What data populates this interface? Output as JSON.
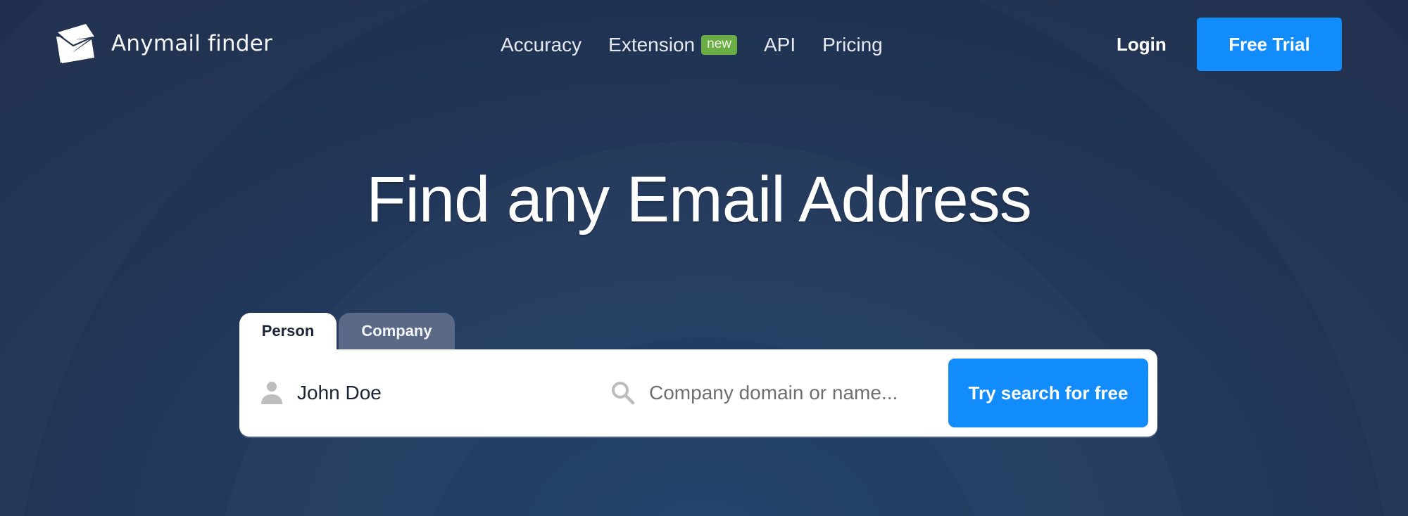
{
  "brand": {
    "name": "Anymail finder",
    "logo_icon": "open-envelope-icon"
  },
  "nav": {
    "items": [
      {
        "label": "Accuracy"
      },
      {
        "label": "Extension",
        "badge": "new"
      },
      {
        "label": "API"
      },
      {
        "label": "Pricing"
      }
    ],
    "login_label": "Login",
    "cta_label": "Free Trial"
  },
  "hero": {
    "title": "Find any Email Address"
  },
  "search": {
    "tabs": [
      {
        "label": "Person",
        "active": true
      },
      {
        "label": "Company",
        "active": false
      }
    ],
    "person_field": {
      "icon": "person-icon",
      "value": "John Doe"
    },
    "company_field": {
      "icon": "search-icon",
      "value": "",
      "placeholder": "Company domain or name..."
    },
    "submit_label": "Try search for free"
  },
  "colors": {
    "accent": "#138cfb",
    "badge": "#6aad45",
    "background": "#223a5e",
    "inactive_tab": "#5a6a86"
  }
}
